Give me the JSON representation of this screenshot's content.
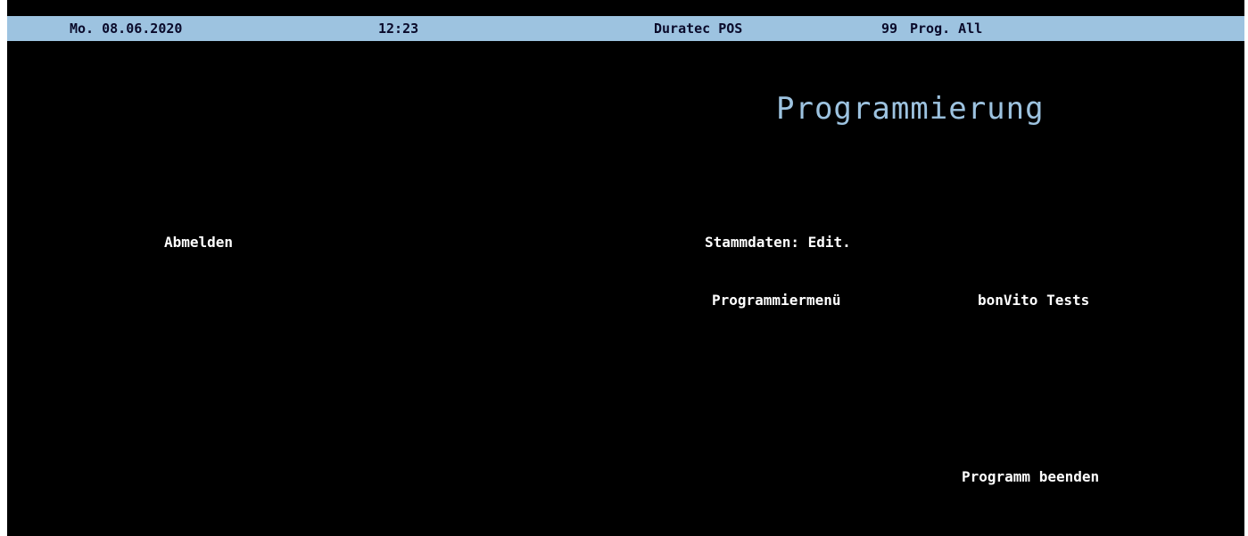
{
  "status_bar": {
    "date": "Mo. 08.06.2020",
    "time": "12:23",
    "app_name": "Duratec POS",
    "user_number": "99",
    "user_name": "Prog. All"
  },
  "page": {
    "title": "Programmierung"
  },
  "menu": {
    "logout": "Abmelden",
    "master_data_edit": "Stammdaten: Edit.",
    "programming_menu": "Programmiermenü",
    "bonvito_tests": "bonVito Tests",
    "exit_program": "Programm beenden"
  },
  "colors": {
    "background": "#000000",
    "status_bar": "#9dc3e0",
    "title": "#9dc3e0",
    "menu_text": "#ffffff"
  }
}
